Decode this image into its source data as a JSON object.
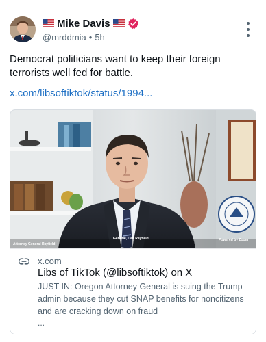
{
  "post": {
    "author": {
      "display_name": "Mike Davis",
      "handle": "@mrddmia",
      "flag_emoji": "🇺🇸",
      "verified_badge_color": "#e0245e"
    },
    "separator": "•",
    "time_ago": "5h",
    "text": "Democrat politicians want to keep their foreign terrorists well fed for battle.",
    "link_text": "x.com/libsoftiktok/status/1994...",
    "link_color": "#1d6fc4"
  },
  "card": {
    "video_captions": {
      "left": "Attorney General Rayfield",
      "center": "General, Dan Rayfield.",
      "right": "Powered by Zoom"
    },
    "domain": "x.com",
    "title": "Libs of TikTok (@libsoftiktok) on X",
    "description": "JUST IN: Oregon Attorney General is suing the Trump admin because they cut SNAP benefits for noncitizens and are cracking down on fraud",
    "ellipsis": "..."
  },
  "icons": {
    "avatar": "avatar-photo",
    "flag": "us-flag-icon",
    "verified": "verified-badge-icon",
    "more": "more-options-icon",
    "link": "link-icon"
  }
}
